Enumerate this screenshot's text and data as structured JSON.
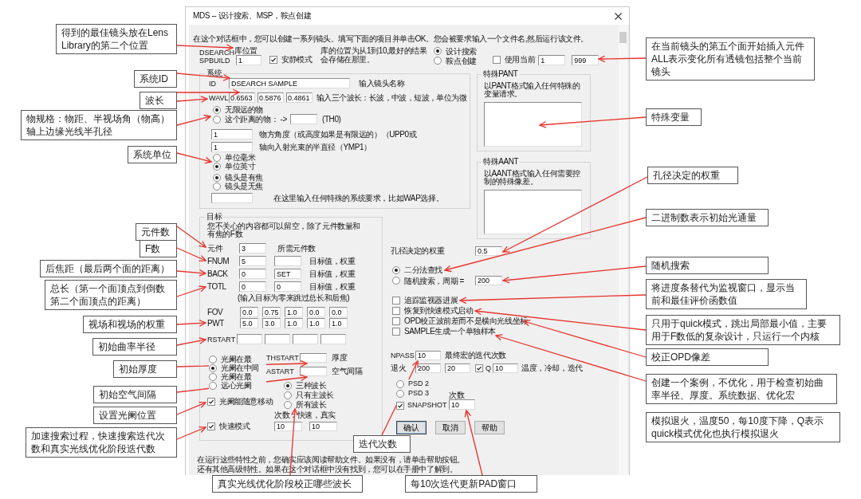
{
  "window": {
    "title": "MDS -- 设计搜索、MSP，鞍点创建"
  },
  "intro": "在这个对话框中，您可以创建一系列镜头。填写下面的项目并单击OK。您会被要求输入一个文件名,然后运行该文件。",
  "library": {
    "names": [
      "DSEARCH",
      "SPBUILD"
    ],
    "label": "库位置",
    "value": "1",
    "note": "库的位置为从1到10,最好的结果会存储在那里。"
  },
  "quiet_mode": {
    "label": "安静模式",
    "checked": true
  },
  "mode": [
    {
      "label": "设计搜索",
      "selected": true
    },
    {
      "label": "鞍点创建",
      "selected": false
    }
  ],
  "use_current": {
    "label": "使用当前",
    "checked": false,
    "values": [
      "1",
      "999"
    ]
  },
  "system": {
    "title": "系统",
    "id": {
      "label": "ID",
      "value": "DSEARCH SAMPLE",
      "hint": "输入镜头名称"
    },
    "wavl": {
      "label": "WAVL",
      "values": [
        "0.6563",
        "0.5876",
        "0.4861"
      ],
      "hint": "输入三个波长：长波，中波，短波，单位为微"
    },
    "object": [
      {
        "label": "无限远的物",
        "selected": true
      },
      {
        "label": "这个距离的物： ->",
        "selected": false
      }
    ],
    "distance_hint": "(TH0)",
    "fields": [
      {
        "value": "1",
        "hint": "物方角度（或高度如果是有限远的）（UPP0或"
      },
      {
        "value": "1",
        "hint": "轴向入射光束的半直径（YMP1）"
      }
    ],
    "units": [
      {
        "label": "单位毫米",
        "selected": false
      },
      {
        "label": "单位英寸",
        "selected": true
      }
    ],
    "focus": [
      {
        "label": "镜头是有焦",
        "selected": true
      },
      {
        "label": "镜头是无焦",
        "selected": false
      }
    ],
    "special_hint": "在这里输入任何特殊的系统要求，比如WAP选择。"
  },
  "pant": {
    "title": "特殊PANT",
    "text": "以PANT格式输入任何特殊的变量请求。"
  },
  "aant": {
    "title": "特殊AANT",
    "text": "以AANT格式输入任何需要控制的特殊像差。"
  },
  "target": {
    "title": "目标",
    "note": "您不关心的内容都可以留空，除了元件数量和有焦的F数",
    "rows": [
      {
        "kind": "single",
        "label": "元件",
        "value": "3",
        "hint": "所需元件数"
      },
      {
        "kind": "pair",
        "label": "FNUM",
        "value": "5",
        "hint": "目标值，权重"
      },
      {
        "kind": "pair",
        "label": "BACK",
        "value": "0",
        "weight": "SET",
        "hint": "目标值，权重"
      },
      {
        "kind": "pair",
        "label": "TOTL",
        "value": "0",
        "weight": "0",
        "hint": "目标值，权重"
      }
    ],
    "skip_note": "(输入目标为零来跳过总长和后焦)",
    "fov": {
      "label": "FOV",
      "values": [
        "0.0",
        "0.75",
        "1.0",
        "0.0",
        "0.0"
      ]
    },
    "pwt": {
      "label": "PWT",
      "values": [
        "5.0",
        "3.0",
        "1.0",
        "1.0",
        "1.0"
      ]
    },
    "rstart_label": "RSTART",
    "stop": [
      {
        "label": "光阑在最",
        "selected": false
      },
      {
        "label": "光阑在中间",
        "selected": true
      },
      {
        "label": "光阑在最",
        "selected": false
      },
      {
        "label": "远心光阑",
        "selected": false
      }
    ],
    "thstart": {
      "label": "THSTART",
      "hint": "厚度"
    },
    "astart": {
      "label": "ASTART",
      "hint": "空气间隔"
    },
    "wavelengths": [
      {
        "label": "三种波长",
        "selected": true
      },
      {
        "label": "只有主波长",
        "selected": false
      },
      {
        "label": "所有波长",
        "selected": false
      }
    ],
    "stop_free": {
      "label": "光阑能随意移动",
      "checked": true
    },
    "passes_label": "次数：快速，真实",
    "quick_mode": {
      "label": "快速模式",
      "checked": true
    },
    "passes": [
      "10",
      "10"
    ]
  },
  "options": {
    "aperture_weight": {
      "label": "孔径决定的权重",
      "value": "0.5"
    },
    "search": [
      {
        "label": "二分法查找",
        "selected": true
      },
      {
        "label": "随机搜索，周期 =",
        "selected": false
      }
    ],
    "period": "200",
    "checks": [
      {
        "label": "追踪监视器进展",
        "checked": false
      },
      {
        "label": "恢复到快速模式启动",
        "checked": false
      },
      {
        "label": "OPD校正波前差而不是横向光线坐标",
        "checked": false
      },
      {
        "label": "SAMPLE生成一个单独样本",
        "checked": false
      }
    ],
    "npass": {
      "label": "NPASS",
      "value": "10",
      "hint": "最终宏的迭代次数"
    },
    "anneal": {
      "label": "退火",
      "values": [
        "200",
        "20"
      ],
      "q": {
        "label": "Q",
        "checked": true
      },
      "q_value": "10",
      "hint": "温度，冷却，迭代"
    },
    "psd": [
      {
        "label": "PSD 2",
        "selected": false
      },
      {
        "label": "PSD 3",
        "selected": false
      }
    ],
    "snapshot": {
      "label": "SNAPSHOT",
      "checked": true
    },
    "count": {
      "label": "次数",
      "value": "10"
    }
  },
  "buttons": [
    {
      "label": "确认",
      "default": true
    },
    {
      "label": "取消",
      "default": false
    },
    {
      "label": "帮助",
      "default": false
    }
  ],
  "footer": [
    "在运行这些特性之前，您确实应该阅读帮助文件。如果没有，请单击帮助按钮。",
    "还有其他高级特性。如果在这个对话框中没有找到，您可以在手册中了解到。"
  ],
  "callouts": [
    {
      "text": "得到的最佳镜头放在Lens Library的第二个位置"
    },
    {
      "text": "系统ID"
    },
    {
      "text": "波长"
    },
    {
      "text": "物规格：物距、半视场角（物高）轴上边缘光线半孔径"
    },
    {
      "text": "系统单位"
    },
    {
      "text": "元件数"
    },
    {
      "text": "F数"
    },
    {
      "text": "后焦距（最后两个面的距离）"
    },
    {
      "text": "总长（第一个面顶点到倒数第二个面顶点的距离）"
    },
    {
      "text": "视场和视场的权重"
    },
    {
      "text": "初始曲率半径"
    },
    {
      "text": "初始厚度"
    },
    {
      "text": "初始空气间隔"
    },
    {
      "text": "设置光阑位置"
    },
    {
      "text": "加速搜索过程，快速搜索迭代次数和真实光线优化阶段迭代数"
    },
    {
      "text": "真实光线优化阶段校正哪些波长"
    },
    {
      "text": "迭代次数"
    },
    {
      "text": "每10次迭代更新PAD窗口"
    },
    {
      "text": "在当前镜头的第五个面开始插入元件ALL表示变化所有透镜包括整个当前镜头"
    },
    {
      "text": "特殊变量"
    },
    {
      "text": "孔径决定的权重"
    },
    {
      "text": "二进制数表示初始光通量"
    },
    {
      "text": "随机搜索"
    },
    {
      "text": "将进度条替代为监视窗口，显示当前和最佳评价函数值"
    },
    {
      "text": "只用于quick模式，跳出局部最小值，主要用于F数低的复杂设计，只运行一个内核"
    },
    {
      "text": "校正OPD像差"
    },
    {
      "text": "创建一个案例，不优化，用于检查初始曲率半径、厚度。系统数据、优化宏"
    },
    {
      "text": "模拟退火，温度50，每10度下降，Q表示quick模式优化也执行模拟退火"
    }
  ]
}
